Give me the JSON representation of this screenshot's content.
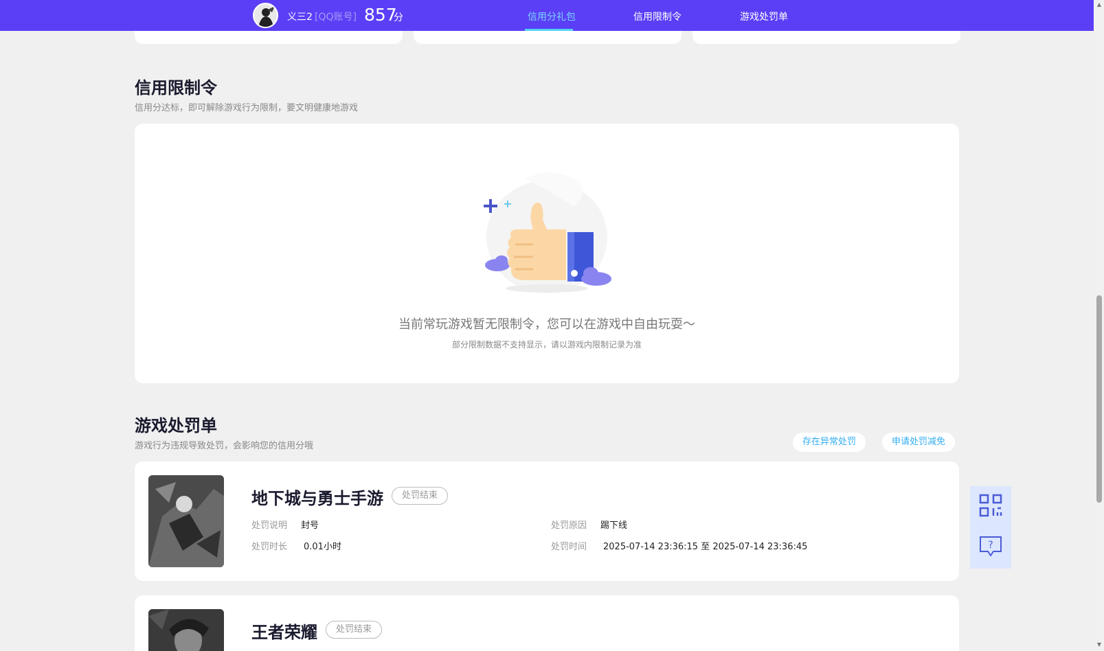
{
  "header": {
    "user_name": "义三2",
    "account_type": "[QQ账号]",
    "score": "857",
    "score_unit": "分",
    "tabs": [
      {
        "label": "信用分礼包",
        "active": true
      },
      {
        "label": "信用限制令",
        "active": false
      },
      {
        "label": "游戏处罚单",
        "active": false
      }
    ]
  },
  "restriction": {
    "title": "信用限制令",
    "subtitle": "信用分达标，即可解除游戏行为限制，要文明健康地游戏",
    "empty_message": "当前常玩游戏暂无限制令，您可以在游戏中自由玩耍～",
    "empty_note": "部分限制数据不支持显示，请以游戏内限制记录为准",
    "illustration_icon": "thumbs-up-icon"
  },
  "penalty": {
    "title": "游戏处罚单",
    "subtitle": "游戏行为违规导致处罚，会影响您的信用分哦",
    "buttons": {
      "abnormal": "存在异常处罚",
      "reduce": "申请处罚减免"
    },
    "records": [
      {
        "game": "地下城与勇士手游",
        "status": "处罚结束",
        "labels": {
          "desc": "处罚说明",
          "reason": "处罚原因",
          "duration": "处罚时长",
          "time": "处罚时间"
        },
        "desc": "封号",
        "reason": "踢下线",
        "duration": "0.01小时",
        "time": "2025-07-14 23:36:15 至 2025-07-14 23:36:45"
      },
      {
        "game": "王者荣耀",
        "status": "处罚结束"
      }
    ]
  },
  "side_buttons": {
    "qr": "qr-code-icon",
    "help": "help-chat-icon"
  },
  "colors": {
    "header_bg": "#5b3ff6",
    "active_tab": "#7ad6ff",
    "link": "#33aef2"
  }
}
